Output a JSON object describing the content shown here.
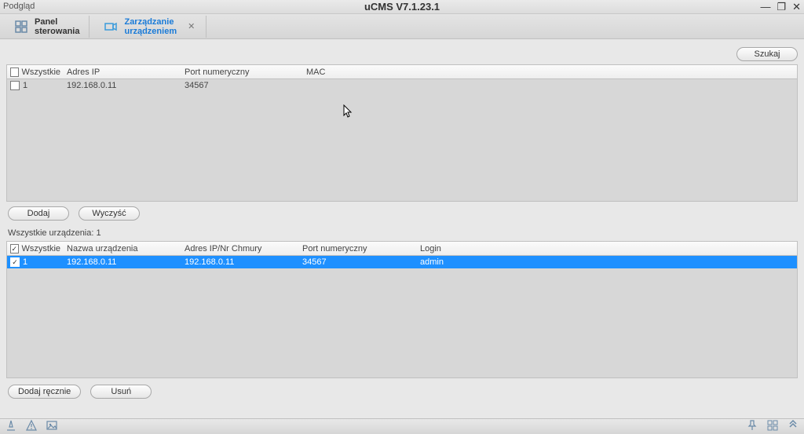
{
  "titlebar": {
    "left_label": "Podgląd",
    "center_title": "uCMS V7.1.23.1",
    "min": "—",
    "restore": "❐",
    "close": "✕"
  },
  "tabs": {
    "control_panel": "Panel\nsterowania",
    "device_mgmt": "Zarządzanie\nurządzeniem",
    "close": "✕"
  },
  "buttons": {
    "search": "Szukaj",
    "add": "Dodaj",
    "clear": "Wyczyść",
    "add_manual": "Dodaj ręcznie",
    "delete": "Usuń"
  },
  "table1": {
    "headers": {
      "all": "Wszystkie",
      "ip": "Adres IP",
      "port": "Port numeryczny",
      "mac": "MAC"
    },
    "row": {
      "num": "1",
      "ip": "192.168.0.11",
      "port": "34567",
      "mac": ""
    }
  },
  "devices_label": "Wszystkie urządzenia: 1",
  "table2": {
    "headers": {
      "all": "Wszystkie",
      "name": "Nazwa urządzenia",
      "ipcloud": "Adres IP/Nr Chmury",
      "port": "Port numeryczny",
      "login": "Login"
    },
    "row": {
      "num": "1",
      "name": "192.168.0.11",
      "ipcloud": "192.168.0.11",
      "port": "34567",
      "login": "admin"
    }
  }
}
